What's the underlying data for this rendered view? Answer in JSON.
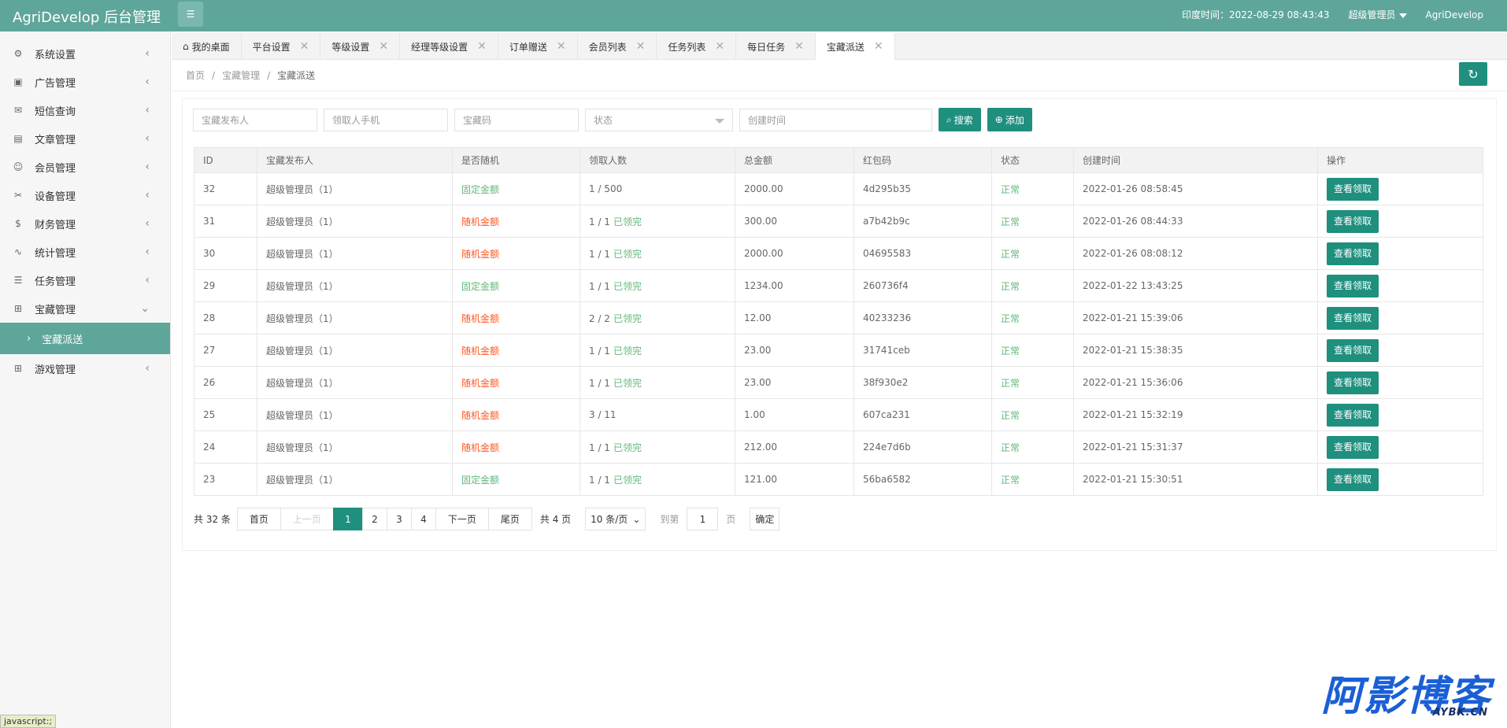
{
  "header": {
    "brand": "AgriDevelop 后台管理",
    "time_label": "印度时间：2022-08-29 08:43:43",
    "role": "超级管理员",
    "username": "AgriDevelop"
  },
  "sidebar": {
    "items": [
      {
        "label": "系统设置",
        "icon": "gear-icon",
        "glyph": "⚙"
      },
      {
        "label": "广告管理",
        "icon": "image-icon",
        "glyph": "▣"
      },
      {
        "label": "短信查询",
        "icon": "mail-icon",
        "glyph": "✉"
      },
      {
        "label": "文章管理",
        "icon": "book-icon",
        "glyph": "▤"
      },
      {
        "label": "会员管理",
        "icon": "user-icon",
        "glyph": "☺"
      },
      {
        "label": "设备管理",
        "icon": "tools-icon",
        "glyph": "✂"
      },
      {
        "label": "财务管理",
        "icon": "dollar-icon",
        "glyph": "$"
      },
      {
        "label": "统计管理",
        "icon": "pulse-icon",
        "glyph": "∿"
      },
      {
        "label": "任务管理",
        "icon": "sliders-icon",
        "glyph": "☰"
      },
      {
        "label": "宝藏管理",
        "icon": "gift-icon",
        "glyph": "⊞"
      }
    ],
    "sub_item": "宝藏派送",
    "last_item": {
      "label": "游戏管理",
      "icon": "gift-icon",
      "glyph": "⊞"
    },
    "status": "javascript:;"
  },
  "tabs": [
    {
      "label": "我的桌面",
      "closable": false
    },
    {
      "label": "平台设置",
      "closable": true
    },
    {
      "label": "等级设置",
      "closable": true
    },
    {
      "label": "经理等级设置",
      "closable": true
    },
    {
      "label": "订单赠送",
      "closable": true
    },
    {
      "label": "会员列表",
      "closable": true
    },
    {
      "label": "任务列表",
      "closable": true
    },
    {
      "label": "每日任务",
      "closable": true
    },
    {
      "label": "宝藏派送",
      "closable": true,
      "active": true
    }
  ],
  "breadcrumb": [
    "首页",
    "宝藏管理",
    "宝藏派送"
  ],
  "filters": {
    "publisher_placeholder": "宝藏发布人",
    "phone_placeholder": "领取人手机",
    "code_placeholder": "宝藏码",
    "status_placeholder": "状态",
    "time_placeholder": "创建时间",
    "search_label": "搜索",
    "add_label": "添加"
  },
  "table": {
    "headers": [
      "ID",
      "宝藏发布人",
      "是否随机",
      "领取人数",
      "总金额",
      "红包码",
      "状态",
      "创建时间",
      "操作"
    ],
    "rows": [
      {
        "id": "32",
        "publisher": "超级管理员（1）",
        "random": "固定金额",
        "random_type": "fixed",
        "count": "1 / 500",
        "done": "",
        "amount": "2000.00",
        "code": "4d295b35",
        "status": "正常",
        "time": "2022-01-26 08:58:45",
        "action": "查看领取"
      },
      {
        "id": "31",
        "publisher": "超级管理员（1）",
        "random": "随机金额",
        "random_type": "random",
        "count": "1 / 1",
        "done": "已领完",
        "amount": "300.00",
        "code": "a7b42b9c",
        "status": "正常",
        "time": "2022-01-26 08:44:33",
        "action": "查看领取"
      },
      {
        "id": "30",
        "publisher": "超级管理员（1）",
        "random": "随机金额",
        "random_type": "random",
        "count": "1 / 1",
        "done": "已领完",
        "amount": "2000.00",
        "code": "04695583",
        "status": "正常",
        "time": "2022-01-26 08:08:12",
        "action": "查看领取"
      },
      {
        "id": "29",
        "publisher": "超级管理员（1）",
        "random": "固定金额",
        "random_type": "fixed",
        "count": "1 / 1",
        "done": "已领完",
        "amount": "1234.00",
        "code": "260736f4",
        "status": "正常",
        "time": "2022-01-22 13:43:25",
        "action": "查看领取"
      },
      {
        "id": "28",
        "publisher": "超级管理员（1）",
        "random": "随机金额",
        "random_type": "random",
        "count": "2 / 2",
        "done": "已领完",
        "amount": "12.00",
        "code": "40233236",
        "status": "正常",
        "time": "2022-01-21 15:39:06",
        "action": "查看领取"
      },
      {
        "id": "27",
        "publisher": "超级管理员（1）",
        "random": "随机金额",
        "random_type": "random",
        "count": "1 / 1",
        "done": "已领完",
        "amount": "23.00",
        "code": "31741ceb",
        "status": "正常",
        "time": "2022-01-21 15:38:35",
        "action": "查看领取"
      },
      {
        "id": "26",
        "publisher": "超级管理员（1）",
        "random": "随机金额",
        "random_type": "random",
        "count": "1 / 1",
        "done": "已领完",
        "amount": "23.00",
        "code": "38f930e2",
        "status": "正常",
        "time": "2022-01-21 15:36:06",
        "action": "查看领取"
      },
      {
        "id": "25",
        "publisher": "超级管理员（1）",
        "random": "随机金额",
        "random_type": "random",
        "count": "3 / 11",
        "done": "",
        "amount": "1.00",
        "code": "607ca231",
        "status": "正常",
        "time": "2022-01-21 15:32:19",
        "action": "查看领取"
      },
      {
        "id": "24",
        "publisher": "超级管理员（1）",
        "random": "随机金额",
        "random_type": "random",
        "count": "1 / 1",
        "done": "已领完",
        "amount": "212.00",
        "code": "224e7d6b",
        "status": "正常",
        "time": "2022-01-21 15:31:37",
        "action": "查看领取"
      },
      {
        "id": "23",
        "publisher": "超级管理员（1）",
        "random": "固定金额",
        "random_type": "fixed",
        "count": "1 / 1",
        "done": "已领完",
        "amount": "121.00",
        "code": "56ba6582",
        "status": "正常",
        "time": "2022-01-21 15:30:51",
        "action": "查看领取"
      }
    ]
  },
  "pager": {
    "total": "共 32 条",
    "first": "首页",
    "prev": "上一页",
    "pages": [
      "1",
      "2",
      "3",
      "4"
    ],
    "current": "1",
    "next": "下一页",
    "last": "尾页",
    "page_count": "共 4 页",
    "per_page": "10 条/页",
    "goto_label": "到第",
    "goto_value": "1",
    "page_unit": "页",
    "confirm": "确定"
  },
  "watermark": {
    "main": "阿影博客",
    "sub": "AYBK.CN"
  },
  "colors": {
    "primary": "#5fa69a",
    "button": "#1f8f7e",
    "fixed": "#5fb878",
    "random": "#ff5722"
  }
}
